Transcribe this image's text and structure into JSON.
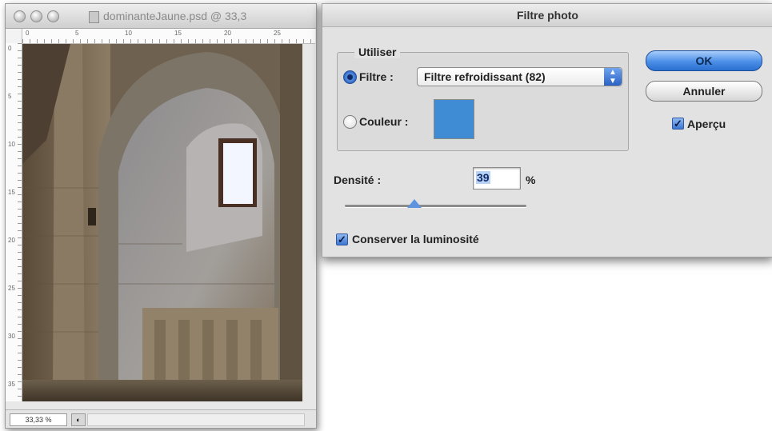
{
  "document_window": {
    "title": "dominanteJaune.psd @ 33,3",
    "zoom": "33,33 %",
    "ruler_top_ticks": [
      "0",
      "5",
      "10",
      "15",
      "20",
      "25"
    ],
    "ruler_left_ticks": [
      "0",
      "5",
      "10",
      "15",
      "20",
      "25",
      "30",
      "35"
    ],
    "status_icon": "navigator-icon"
  },
  "dialog": {
    "title": "Filtre photo",
    "group_label": "Utiliser",
    "filter_radio_label": "Filtre :",
    "filter_selected": "Filtre refroidissant (82)",
    "color_radio_label": "Couleur :",
    "color_swatch": "#3f8bd4",
    "ok_label": "OK",
    "cancel_label": "Annuler",
    "preview_label": "Aperçu",
    "preview_checked": true,
    "density_label": "Densité :",
    "density_value": "39",
    "density_unit": "%",
    "density_percent": 39,
    "preserve_luminosity_label": "Conserver la luminosité",
    "preserve_luminosity_checked": true
  },
  "colors": {
    "accent": "#2a62c4",
    "dialog_bg": "#e2e2e2"
  }
}
